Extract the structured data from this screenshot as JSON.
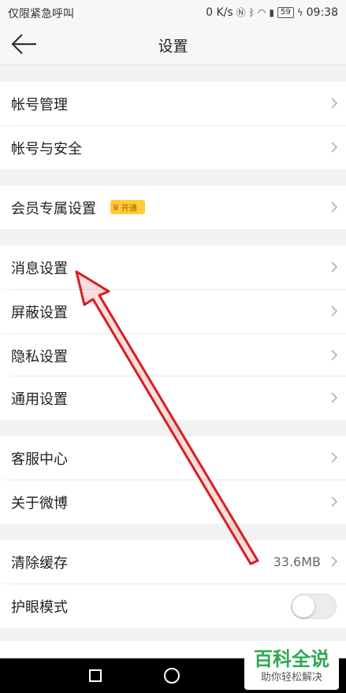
{
  "status_bar": {
    "carrier": "仅限紧急呼叫",
    "speed": "0 K/s",
    "battery": "59",
    "time": "09:38"
  },
  "header": {
    "title": "设置"
  },
  "settings": {
    "account_manage": "帐号管理",
    "account_security": "帐号与安全",
    "vip_settings": "会员专属设置",
    "vip_badge": "开通",
    "message_settings": "消息设置",
    "block_settings": "屏蔽设置",
    "privacy_settings": "隐私设置",
    "general_settings": "通用设置",
    "customer_service": "客服中心",
    "about_weibo": "关于微博",
    "clear_cache": "清除缓存",
    "cache_size": "33.6MB",
    "eye_protection": "护眼模式",
    "eye_protection_on": false
  },
  "watermark": {
    "title": "百科全说",
    "subtitle": "助你轻松解决"
  }
}
